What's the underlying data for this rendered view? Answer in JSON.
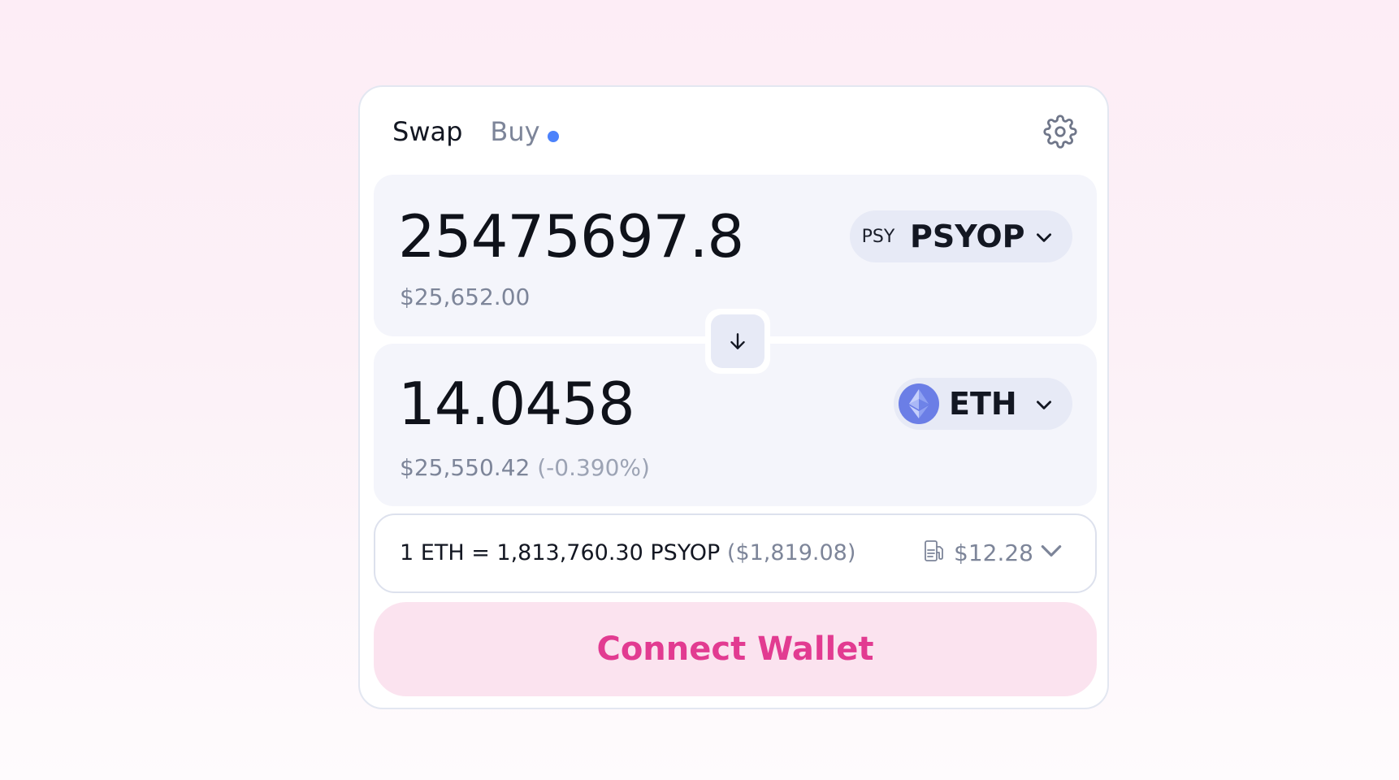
{
  "tabs": {
    "swap": "Swap",
    "buy": "Buy"
  },
  "colors": {
    "accent_pink": "#e23b91",
    "connect_bg": "#fbe3ef",
    "buy_dot": "#4c82fb",
    "eth_logo": "#6b7ee6"
  },
  "sell": {
    "amount": "25475697.8",
    "usd_value": "$25,652.00",
    "token_logo_text": "PSY",
    "token_symbol": "PSYOP"
  },
  "buy": {
    "amount": "14.0458",
    "usd_value": "$25,550.42",
    "price_impact": "(-0.390%)",
    "token_symbol": "ETH"
  },
  "rate": {
    "text": "1 ETH = 1,813,760.30 PSYOP",
    "fiat": "($1,819.08)",
    "gas_cost": "$12.28"
  },
  "icons": {
    "settings": "gear-icon",
    "switch": "arrow-down-icon",
    "eth": "ethereum-icon",
    "gas": "gas-pump-icon",
    "dropdown": "chevron-down-icon"
  },
  "connect_button": "Connect Wallet"
}
